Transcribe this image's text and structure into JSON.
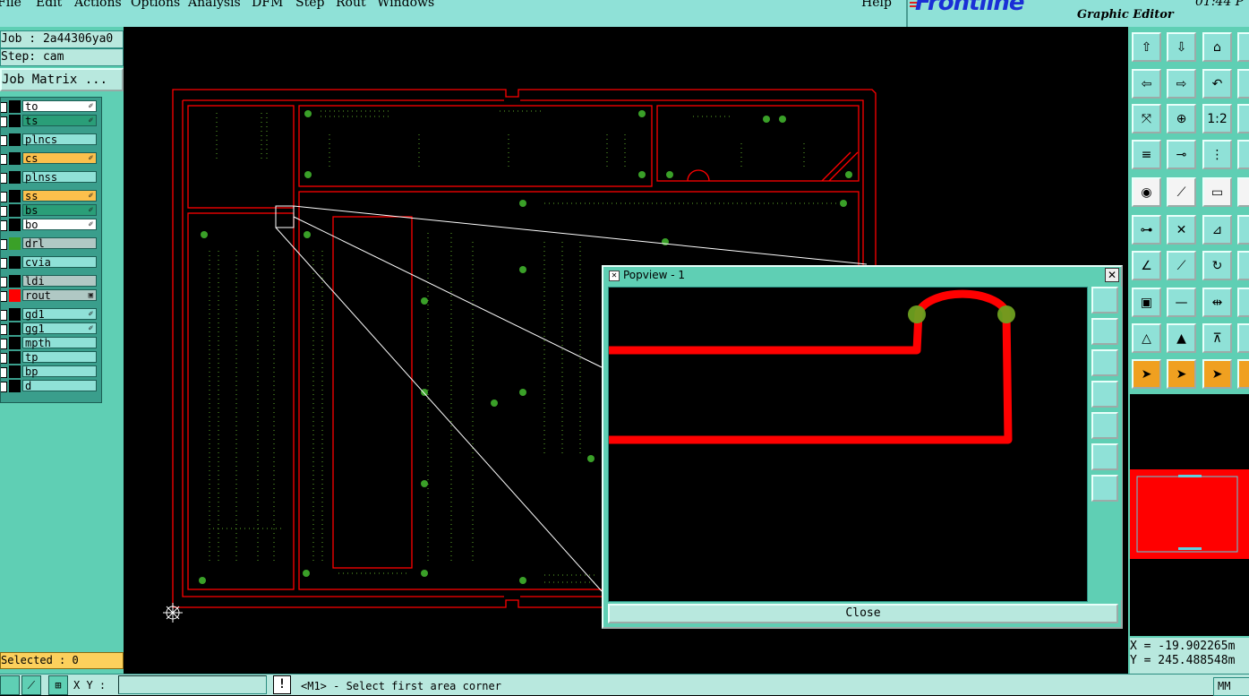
{
  "menu": {
    "items": [
      "File",
      "Edit",
      "Actions",
      "Options",
      "Analysis",
      "DFM",
      "Step",
      "Rout",
      "Windows"
    ],
    "help": "Help"
  },
  "header": {
    "logo": "Frontline",
    "subtitle": "Graphic Editor",
    "clock": "01:44 P"
  },
  "job": {
    "job_line": "Job : 2a44306ya0",
    "step_line": "Step: cam",
    "matrix_button": "Job Matrix ..."
  },
  "layers": [
    {
      "name": "to",
      "color": "#ffffff",
      "swatch": "#000000",
      "flag": "✐"
    },
    {
      "name": "ts",
      "color": "#2a9e78",
      "swatch": "#000000",
      "flag": "✐"
    },
    {
      "name": "plncs",
      "color": "#8fe1d7",
      "swatch": "#000000",
      "flag": ""
    },
    {
      "name": "cs",
      "color": "#fcc04c",
      "swatch": "#000000",
      "flag": "✐"
    },
    {
      "name": "plnss",
      "color": "#8fe1d7",
      "swatch": "#000000",
      "flag": ""
    },
    {
      "name": "ss",
      "color": "#fcc04c",
      "swatch": "#000000",
      "flag": "✐"
    },
    {
      "name": "bs",
      "color": "#2a9e78",
      "swatch": "#000000",
      "flag": "✐"
    },
    {
      "name": "bo",
      "color": "#ffffff",
      "swatch": "#000000",
      "flag": "✐"
    },
    {
      "name": "drl",
      "color": "#b0c8c4",
      "swatch": "#3aa028",
      "flag": ""
    },
    {
      "name": "cvia",
      "color": "#8fe1d7",
      "swatch": "#000000",
      "flag": ""
    },
    {
      "name": "ldi",
      "color": "#b0c8c4",
      "swatch": "#000000",
      "flag": ""
    },
    {
      "name": "rout",
      "color": "#b0c8c4",
      "swatch": "#ff0000",
      "flag": "▣"
    },
    {
      "name": "gd1",
      "color": "#8fe1d7",
      "swatch": "#000000",
      "flag": "✐"
    },
    {
      "name": "gg1",
      "color": "#8fe1d7",
      "swatch": "#000000",
      "flag": "✐"
    },
    {
      "name": "mpth",
      "color": "#8fe1d7",
      "swatch": "#000000",
      "flag": ""
    },
    {
      "name": "tp",
      "color": "#8fe1d7",
      "swatch": "#000000",
      "flag": ""
    },
    {
      "name": "bp",
      "color": "#8fe1d7",
      "swatch": "#000000",
      "flag": ""
    },
    {
      "name": "d",
      "color": "#8fe1d7",
      "swatch": "#000000",
      "flag": ""
    }
  ],
  "status": {
    "selected": "Selected : 0",
    "xy_label": "X Y :",
    "xy_value": "",
    "prompt": "<M1> - Select first area corner",
    "units": "MM"
  },
  "coords": {
    "x": "X = -19.902265m",
    "y": "Y = 245.488548m"
  },
  "popview": {
    "title": "Popview - 1",
    "close_label": "Close"
  },
  "colors": {
    "panel": "#5fcfb4",
    "light_panel": "#8fe1d7",
    "rout": "#ff0000",
    "pad": "#3aa028"
  }
}
